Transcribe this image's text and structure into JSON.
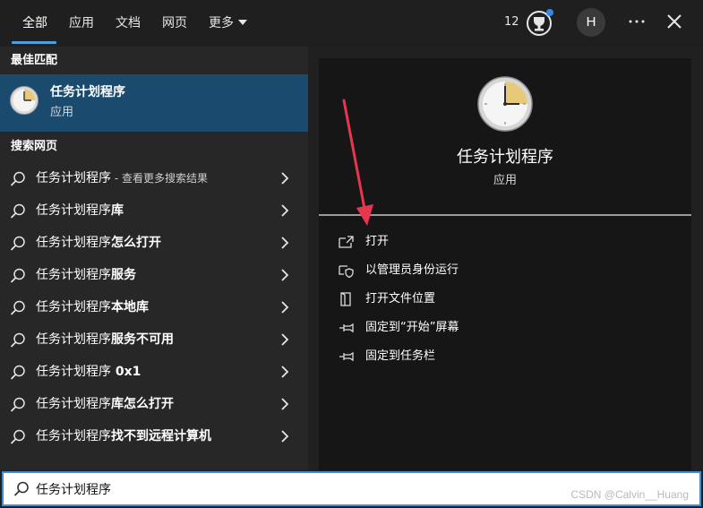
{
  "tabs": [
    {
      "label": "全部",
      "active": true
    },
    {
      "label": "应用"
    },
    {
      "label": "文档"
    },
    {
      "label": "网页"
    },
    {
      "label": "更多"
    }
  ],
  "header": {
    "points": "12",
    "avatar_initial": "H",
    "reward_icon": "rewards-trophy-icon",
    "more_icon": "ellipsis-icon",
    "close_icon": "close-icon",
    "notification_dot_color": "#2f8be6"
  },
  "left": {
    "best_match_heading": "最佳匹配",
    "best_match": {
      "title": "任务计划程序",
      "subtitle": "应用"
    },
    "web_heading": "搜索网页",
    "web_results": [
      {
        "prefix": "任务计划程序",
        "bold": "",
        "hint": " - 查看更多搜索结果"
      },
      {
        "prefix": "任务计划程序",
        "bold": "库",
        "hint": ""
      },
      {
        "prefix": "任务计划程序",
        "bold": "怎么打开",
        "hint": ""
      },
      {
        "prefix": "任务计划程序",
        "bold": "服务",
        "hint": ""
      },
      {
        "prefix": "任务计划程序",
        "bold": "本地库",
        "hint": ""
      },
      {
        "prefix": "任务计划程序",
        "bold": "服务不可用",
        "hint": ""
      },
      {
        "prefix": "任务计划程序",
        "bold": " 0x1",
        "hint": ""
      },
      {
        "prefix": "任务计划程序",
        "bold": "库怎么打开",
        "hint": ""
      },
      {
        "prefix": "任务计划程序",
        "bold": "找不到远程计算机",
        "hint": ""
      }
    ]
  },
  "right": {
    "app_name": "任务计划程序",
    "app_type": "应用",
    "actions": [
      {
        "label": "打开",
        "icon": "open-icon"
      },
      {
        "label": "以管理员身份运行",
        "icon": "shield-icon"
      },
      {
        "label": "打开文件位置",
        "icon": "folder-icon"
      },
      {
        "label": "固定到“开始”屏幕",
        "icon": "pin-icon"
      },
      {
        "label": "固定到任务栏",
        "icon": "pin-icon"
      }
    ]
  },
  "search": {
    "value": "任务计划程序",
    "watermark": "CSDN @Calvin__Huang"
  },
  "colors": {
    "accent": "#4ca0e0",
    "selected_row": "#1a4a6e",
    "annotation_arrow": "#e8364f"
  }
}
